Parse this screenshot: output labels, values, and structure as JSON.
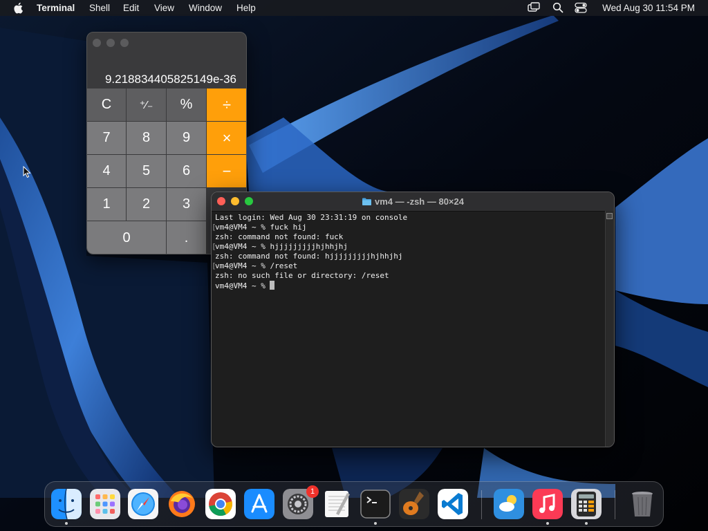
{
  "menubar": {
    "app_name": "Terminal",
    "menus": [
      "Shell",
      "Edit",
      "View",
      "Window",
      "Help"
    ],
    "clock": "Wed Aug 30  11:54 PM",
    "status_icons": [
      "screen-mirroring-icon",
      "search-icon",
      "control-center-icon"
    ]
  },
  "calculator": {
    "display": "9.218834405825149e-36",
    "keys": {
      "clear": "C",
      "sign": "⁺∕₋",
      "percent": "%",
      "divide": "÷",
      "seven": "7",
      "eight": "8",
      "nine": "9",
      "multiply": "×",
      "four": "4",
      "five": "5",
      "six": "6",
      "minus": "−",
      "one": "1",
      "two": "2",
      "three": "3",
      "zero": "0",
      "decimal": "."
    },
    "colors": {
      "operator": "#ff9f0a",
      "number": "#7b7b7d",
      "function": "#5e5e60"
    }
  },
  "terminal": {
    "title": "vm4 — -zsh — 80×24",
    "lines": [
      "Last login: Wed Aug 30 23:31:19 on console",
      "vm4@VM4 ~ % fuck hij",
      "zsh: command not found: fuck",
      "vm4@VM4 ~ % hjjjjjjjjjhjhhjhj",
      "zsh: command not found: hjjjjjjjjjhjhhjhj",
      "vm4@VM4 ~ % /reset",
      "zsh: no such file or directory: /reset",
      "vm4@VM4 ~ % "
    ],
    "bracket_left": "[",
    "bracket_right": "]"
  },
  "dock": {
    "apps": [
      "Finder",
      "Launchpad",
      "Safari",
      "Firefox",
      "Chrome",
      "App Store",
      "System Settings",
      "TextEdit",
      "Terminal",
      "GarageBand",
      "Visual Studio Code",
      "Weather",
      "Music",
      "Calculator",
      "Trash"
    ],
    "settings_badge": "1"
  }
}
